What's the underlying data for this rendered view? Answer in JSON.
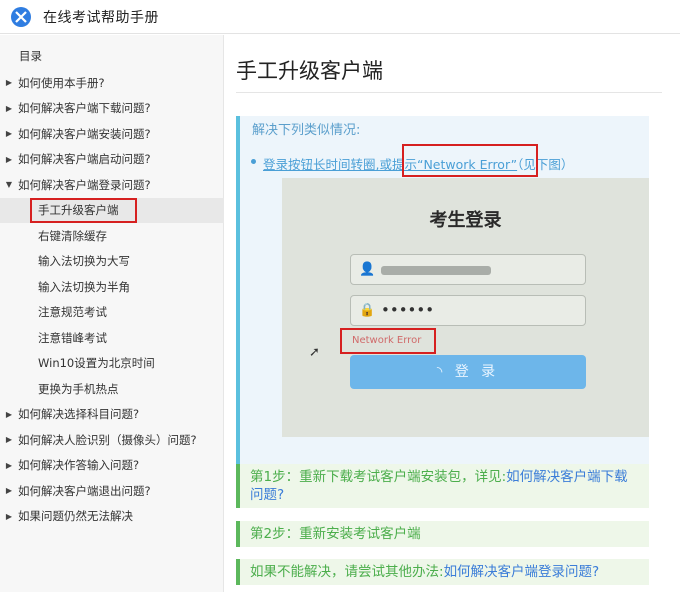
{
  "header": {
    "title": "在线考试帮助手册",
    "logo_icon": "x-logo-icon"
  },
  "sidebar": {
    "toc_label": "目录",
    "items": [
      {
        "label": "如何使用本手册?",
        "arrow": "▶"
      },
      {
        "label": "如何解决客户端下载问题?",
        "arrow": "▶"
      },
      {
        "label": "如何解决客户端安装问题?",
        "arrow": "▶"
      },
      {
        "label": "如何解决客户端启动问题?",
        "arrow": "▶"
      },
      {
        "label": "如何解决客户端登录问题?",
        "arrow": "▼"
      },
      {
        "label": "手工升级客户端",
        "sub": true,
        "active": true
      },
      {
        "label": "右键清除缓存",
        "sub": true
      },
      {
        "label": "输入法切换为大写",
        "sub": true
      },
      {
        "label": "输入法切换为半角",
        "sub": true
      },
      {
        "label": "注意规范考试",
        "sub": true
      },
      {
        "label": "注意错峰考试",
        "sub": true
      },
      {
        "label": "Win10设置为北京时间",
        "sub": true
      },
      {
        "label": "更换为手机热点",
        "sub": true
      },
      {
        "label": "如何解决选择科目问题?",
        "arrow": "▶"
      },
      {
        "label": "如何解决人脸识别（摄像头）问题?",
        "arrow": "▶"
      },
      {
        "label": "如何解决作答输入问题?",
        "arrow": "▶"
      },
      {
        "label": "如何解决客户端退出问题?",
        "arrow": "▶"
      },
      {
        "label": "如果问题仍然无法解决",
        "arrow": "▶"
      }
    ]
  },
  "main": {
    "title": "手工升级客户端",
    "info": {
      "heading": "解决下列类似情况:",
      "bullet_part1": "登录按钮长时间转圈,",
      "bullet_part2": "或提示“Network Error”",
      "bullet_part3": "（见下图）",
      "photo": {
        "title": "考生登录",
        "password_mask": "••••••",
        "error_text": "Network Error",
        "button_label": "登 录",
        "spinner": "◝"
      }
    },
    "step1_text": "第1步：重新下载考试客户端安装包，详见:",
    "step1_link": "如何解决客户端下载问题?",
    "step2_text": "第2步：重新安装考试客户端",
    "step3_text": "如果不能解决，请尝试其他办法:",
    "step3_link": "如何解决客户端登录问题?"
  },
  "colors": {
    "highlight": "#d62020",
    "info_accent": "#5bc0de",
    "success_accent": "#5cb85c",
    "link": "#3b7dd8"
  }
}
